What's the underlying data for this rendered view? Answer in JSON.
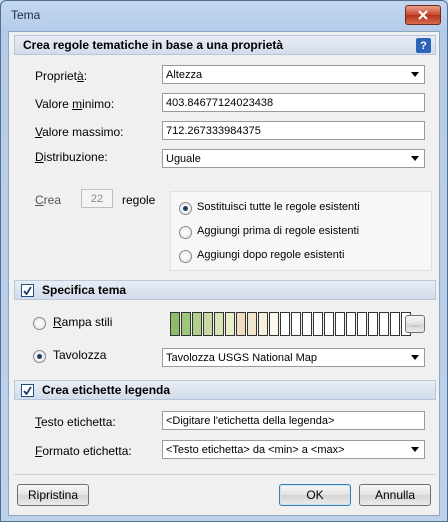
{
  "window": {
    "title": "Tema"
  },
  "section_regole": {
    "header": "Crea regole tematiche in base a una proprietà",
    "help": "?",
    "proprieta_label_pre": "Propriet",
    "proprieta_label_u": "à",
    "proprieta_label_post": ":",
    "proprieta_value": "Altezza",
    "min_label_pre": "Valore ",
    "min_label_u": "m",
    "min_label_post": "inimo:",
    "min_value": "403.84677124023438",
    "max_label_u": "V",
    "max_label_post": "alore massimo:",
    "max_value": "712.267333984375",
    "distr_label_u": "D",
    "distr_label_post": "istribuzione:",
    "distr_value": "Uguale",
    "crea_label_u": "C",
    "crea_label_post": "rea",
    "crea_count": "22",
    "regole_label": "regole",
    "options": [
      {
        "label": "Sostituisci tutte le regole esistenti",
        "selected": true
      },
      {
        "label": "Aggiungi prima di regole esistenti",
        "selected": false
      },
      {
        "label": "Aggiungi dopo regole esistenti",
        "selected": false
      }
    ]
  },
  "section_tema": {
    "header": "Specifica tema",
    "checked": true,
    "rampa_label_u": "R",
    "rampa_label_post": "ampa stili",
    "rampa_selected": false,
    "tavolozza_label": "Tavolozza",
    "tavolozza_selected": true,
    "tavolozza_value": "Tavolozza USGS National Map",
    "browse_label": "...",
    "ramp_colors": [
      "#8fbc6a",
      "#a0c679",
      "#b2d08d",
      "#c5dba2",
      "#d6e6b6",
      "#e7eeca",
      "#eedbc0",
      "#f0e6cc",
      "#f7eedc",
      "#fcf7ec",
      "#ffffff",
      "#ffffff",
      "#ffffff",
      "#ffffff",
      "#ffffff",
      "#ffffff",
      "#ffffff",
      "#ffffff",
      "#ffffff",
      "#ffffff",
      "#ffffff",
      "#ffffff"
    ]
  },
  "section_legenda": {
    "header": "Crea etichette legenda",
    "checked": true,
    "testo_label_u": "T",
    "testo_label_post": "esto etichetta:",
    "testo_value": "<Digitare l'etichetta della legenda>",
    "formato_label_u": "F",
    "formato_label_post": "ormato etichetta:",
    "formato_value": "<Testo etichetta> da <min> a <max>"
  },
  "footer": {
    "ripristina": "Ripristina",
    "ok": "OK",
    "annulla": "Annulla"
  }
}
